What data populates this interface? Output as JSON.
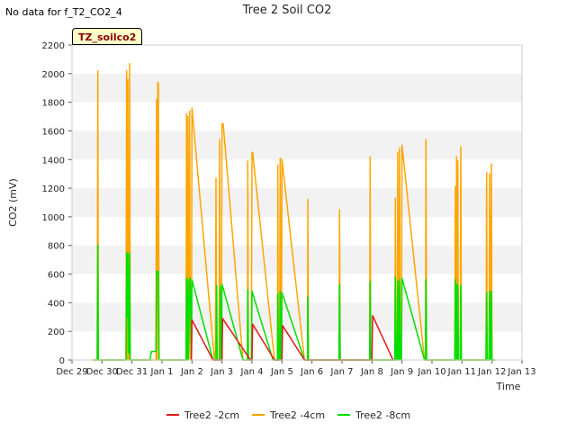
{
  "header": {
    "no_data_text": "No data for f_T2_CO2_4"
  },
  "badge_label": "TZ_soilco2",
  "chart_data": {
    "type": "line",
    "title": "Tree 2 Soil CO2",
    "xlabel": "Time",
    "ylabel": "CO2 (mV)",
    "x_ticks": [
      "Dec 29",
      "Dec 30",
      "Dec 31",
      "Jan 1",
      "Jan 2",
      "Jan 3",
      "Jan 4",
      "Jan 5",
      "Jan 6",
      "Jan 7",
      "Jan 8",
      "Jan 9",
      "Jan 10",
      "Jan 11",
      "Jan 12",
      "Jan 13"
    ],
    "xlim": [
      0,
      15
    ],
    "ylim": [
      0,
      2200
    ],
    "y_ticks": [
      0,
      200,
      400,
      600,
      800,
      1000,
      1200,
      1400,
      1600,
      1800,
      2000,
      2200
    ],
    "grid": "horizontal bands",
    "legend_position": "bottom",
    "series": [
      {
        "name": "Tree2 -2cm",
        "color": "#e31a1c",
        "points": [
          [
            3.98,
            0
          ],
          [
            4.0,
            280
          ],
          [
            4.7,
            0
          ],
          [
            5.0,
            0
          ],
          [
            5.02,
            290
          ],
          [
            5.95,
            0
          ],
          [
            6.0,
            0
          ],
          [
            6.02,
            250
          ],
          [
            6.75,
            0
          ],
          [
            7.0,
            0
          ],
          [
            7.02,
            240
          ],
          [
            7.75,
            0
          ],
          [
            10.0,
            0
          ],
          [
            10.02,
            310
          ],
          [
            10.7,
            0
          ]
        ]
      },
      {
        "name": "Tree2 -4cm",
        "color": "#ffa500",
        "points": [
          [
            0.7,
            0
          ],
          [
            0.84,
            0
          ],
          [
            0.86,
            2020
          ],
          [
            0.88,
            0
          ],
          [
            1.8,
            0
          ],
          [
            1.82,
            2020
          ],
          [
            1.84,
            0
          ],
          [
            1.86,
            1960
          ],
          [
            1.88,
            0
          ],
          [
            1.9,
            0
          ],
          [
            1.92,
            2070
          ],
          [
            1.94,
            0
          ],
          [
            2.6,
            0
          ],
          [
            2.8,
            0
          ],
          [
            2.82,
            1820
          ],
          [
            2.84,
            0
          ],
          [
            2.86,
            1940
          ],
          [
            2.88,
            1930
          ],
          [
            2.9,
            0
          ],
          [
            3.8,
            0
          ],
          [
            3.82,
            1720
          ],
          [
            3.84,
            0
          ],
          [
            3.86,
            1700
          ],
          [
            3.88,
            0
          ],
          [
            3.92,
            1740
          ],
          [
            3.94,
            0
          ],
          [
            3.98,
            0
          ],
          [
            4.0,
            1760
          ],
          [
            4.75,
            0
          ],
          [
            4.78,
            0
          ],
          [
            4.8,
            1270
          ],
          [
            4.82,
            0
          ],
          [
            4.9,
            0
          ],
          [
            4.92,
            1540
          ],
          [
            4.94,
            0
          ],
          [
            4.98,
            0
          ],
          [
            5.0,
            1650
          ],
          [
            5.04,
            1650
          ],
          [
            5.7,
            0
          ],
          [
            5.85,
            0
          ],
          [
            5.86,
            1390
          ],
          [
            5.88,
            0
          ],
          [
            5.98,
            0
          ],
          [
            6.0,
            1450
          ],
          [
            6.02,
            1450
          ],
          [
            6.75,
            0
          ],
          [
            6.85,
            0
          ],
          [
            6.86,
            1360
          ],
          [
            6.88,
            0
          ],
          [
            6.92,
            0
          ],
          [
            6.94,
            1410
          ],
          [
            6.96,
            0
          ],
          [
            6.98,
            0
          ],
          [
            7.0,
            1400
          ],
          [
            7.75,
            0
          ],
          [
            7.85,
            0
          ],
          [
            7.86,
            1120
          ],
          [
            7.88,
            0
          ],
          [
            8.9,
            0
          ],
          [
            8.92,
            1050
          ],
          [
            8.94,
            0
          ],
          [
            9.92,
            0
          ],
          [
            9.94,
            1420
          ],
          [
            9.96,
            0
          ],
          [
            10.76,
            0
          ],
          [
            10.78,
            1130
          ],
          [
            10.8,
            0
          ],
          [
            10.84,
            0
          ],
          [
            10.86,
            1450
          ],
          [
            10.88,
            0
          ],
          [
            10.9,
            0
          ],
          [
            10.92,
            1480
          ],
          [
            10.94,
            0
          ],
          [
            10.98,
            0
          ],
          [
            11.0,
            1500
          ],
          [
            11.75,
            0
          ],
          [
            11.78,
            0
          ],
          [
            11.8,
            1540
          ],
          [
            11.82,
            0
          ],
          [
            12.76,
            0
          ],
          [
            12.78,
            1210
          ],
          [
            12.8,
            0
          ],
          [
            12.82,
            1420
          ],
          [
            12.84,
            0
          ],
          [
            12.86,
            1390
          ],
          [
            12.88,
            0
          ],
          [
            12.94,
            0
          ],
          [
            12.96,
            1490
          ],
          [
            12.98,
            0
          ],
          [
            13.8,
            0
          ],
          [
            13.82,
            1310
          ],
          [
            13.84,
            0
          ],
          [
            13.9,
            0
          ],
          [
            13.92,
            1300
          ],
          [
            13.94,
            0
          ],
          [
            13.96,
            0
          ],
          [
            13.98,
            1370
          ],
          [
            14.0,
            0
          ],
          [
            14.1,
            0
          ]
        ]
      },
      {
        "name": "Tree2 -8cm",
        "color": "#00e000",
        "points": [
          [
            0.7,
            0
          ],
          [
            0.84,
            0
          ],
          [
            0.86,
            800
          ],
          [
            0.88,
            0
          ],
          [
            1.8,
            0
          ],
          [
            1.82,
            750
          ],
          [
            1.84,
            300
          ],
          [
            1.86,
            740
          ],
          [
            1.88,
            50
          ],
          [
            1.9,
            50
          ],
          [
            1.92,
            750
          ],
          [
            1.94,
            0
          ],
          [
            2.6,
            0
          ],
          [
            2.65,
            60
          ],
          [
            2.8,
            60
          ],
          [
            2.82,
            620
          ],
          [
            2.84,
            600
          ],
          [
            2.88,
            620
          ],
          [
            2.9,
            0
          ],
          [
            3.8,
            0
          ],
          [
            3.82,
            570
          ],
          [
            3.84,
            0
          ],
          [
            3.86,
            560
          ],
          [
            3.88,
            0
          ],
          [
            3.92,
            570
          ],
          [
            3.94,
            570
          ],
          [
            3.98,
            0
          ],
          [
            4.0,
            560
          ],
          [
            4.7,
            0
          ],
          [
            4.8,
            0
          ],
          [
            4.82,
            520
          ],
          [
            4.84,
            0
          ],
          [
            4.92,
            0
          ],
          [
            4.94,
            510
          ],
          [
            4.96,
            0
          ],
          [
            4.98,
            0
          ],
          [
            5.0,
            530
          ],
          [
            5.7,
            0
          ],
          [
            5.85,
            0
          ],
          [
            5.86,
            490
          ],
          [
            5.88,
            0
          ],
          [
            5.98,
            0
          ],
          [
            6.0,
            480
          ],
          [
            6.7,
            0
          ],
          [
            6.85,
            0
          ],
          [
            6.86,
            460
          ],
          [
            6.88,
            0
          ],
          [
            6.92,
            0
          ],
          [
            6.94,
            480
          ],
          [
            6.96,
            0
          ],
          [
            6.98,
            0
          ],
          [
            7.0,
            470
          ],
          [
            7.75,
            0
          ],
          [
            7.85,
            0
          ],
          [
            7.86,
            440
          ],
          [
            7.88,
            0
          ],
          [
            8.9,
            0
          ],
          [
            8.92,
            530
          ],
          [
            8.94,
            0
          ],
          [
            9.92,
            0
          ],
          [
            9.94,
            550
          ],
          [
            9.96,
            0
          ],
          [
            10.76,
            0
          ],
          [
            10.78,
            580
          ],
          [
            10.8,
            0
          ],
          [
            10.84,
            0
          ],
          [
            10.86,
            550
          ],
          [
            10.88,
            0
          ],
          [
            10.9,
            0
          ],
          [
            10.92,
            560
          ],
          [
            10.94,
            0
          ],
          [
            10.98,
            0
          ],
          [
            11.0,
            570
          ],
          [
            11.75,
            0
          ],
          [
            11.78,
            0
          ],
          [
            11.8,
            560
          ],
          [
            11.82,
            0
          ],
          [
            12.76,
            0
          ],
          [
            12.78,
            560
          ],
          [
            12.8,
            0
          ],
          [
            12.82,
            530
          ],
          [
            12.84,
            0
          ],
          [
            12.86,
            520
          ],
          [
            12.88,
            0
          ],
          [
            12.94,
            0
          ],
          [
            12.96,
            520
          ],
          [
            12.98,
            0
          ],
          [
            13.8,
            0
          ],
          [
            13.82,
            470
          ],
          [
            13.84,
            0
          ],
          [
            13.9,
            0
          ],
          [
            13.92,
            480
          ],
          [
            13.94,
            0
          ],
          [
            13.96,
            0
          ],
          [
            13.98,
            480
          ],
          [
            14.0,
            0
          ],
          [
            14.1,
            0
          ]
        ]
      }
    ]
  }
}
